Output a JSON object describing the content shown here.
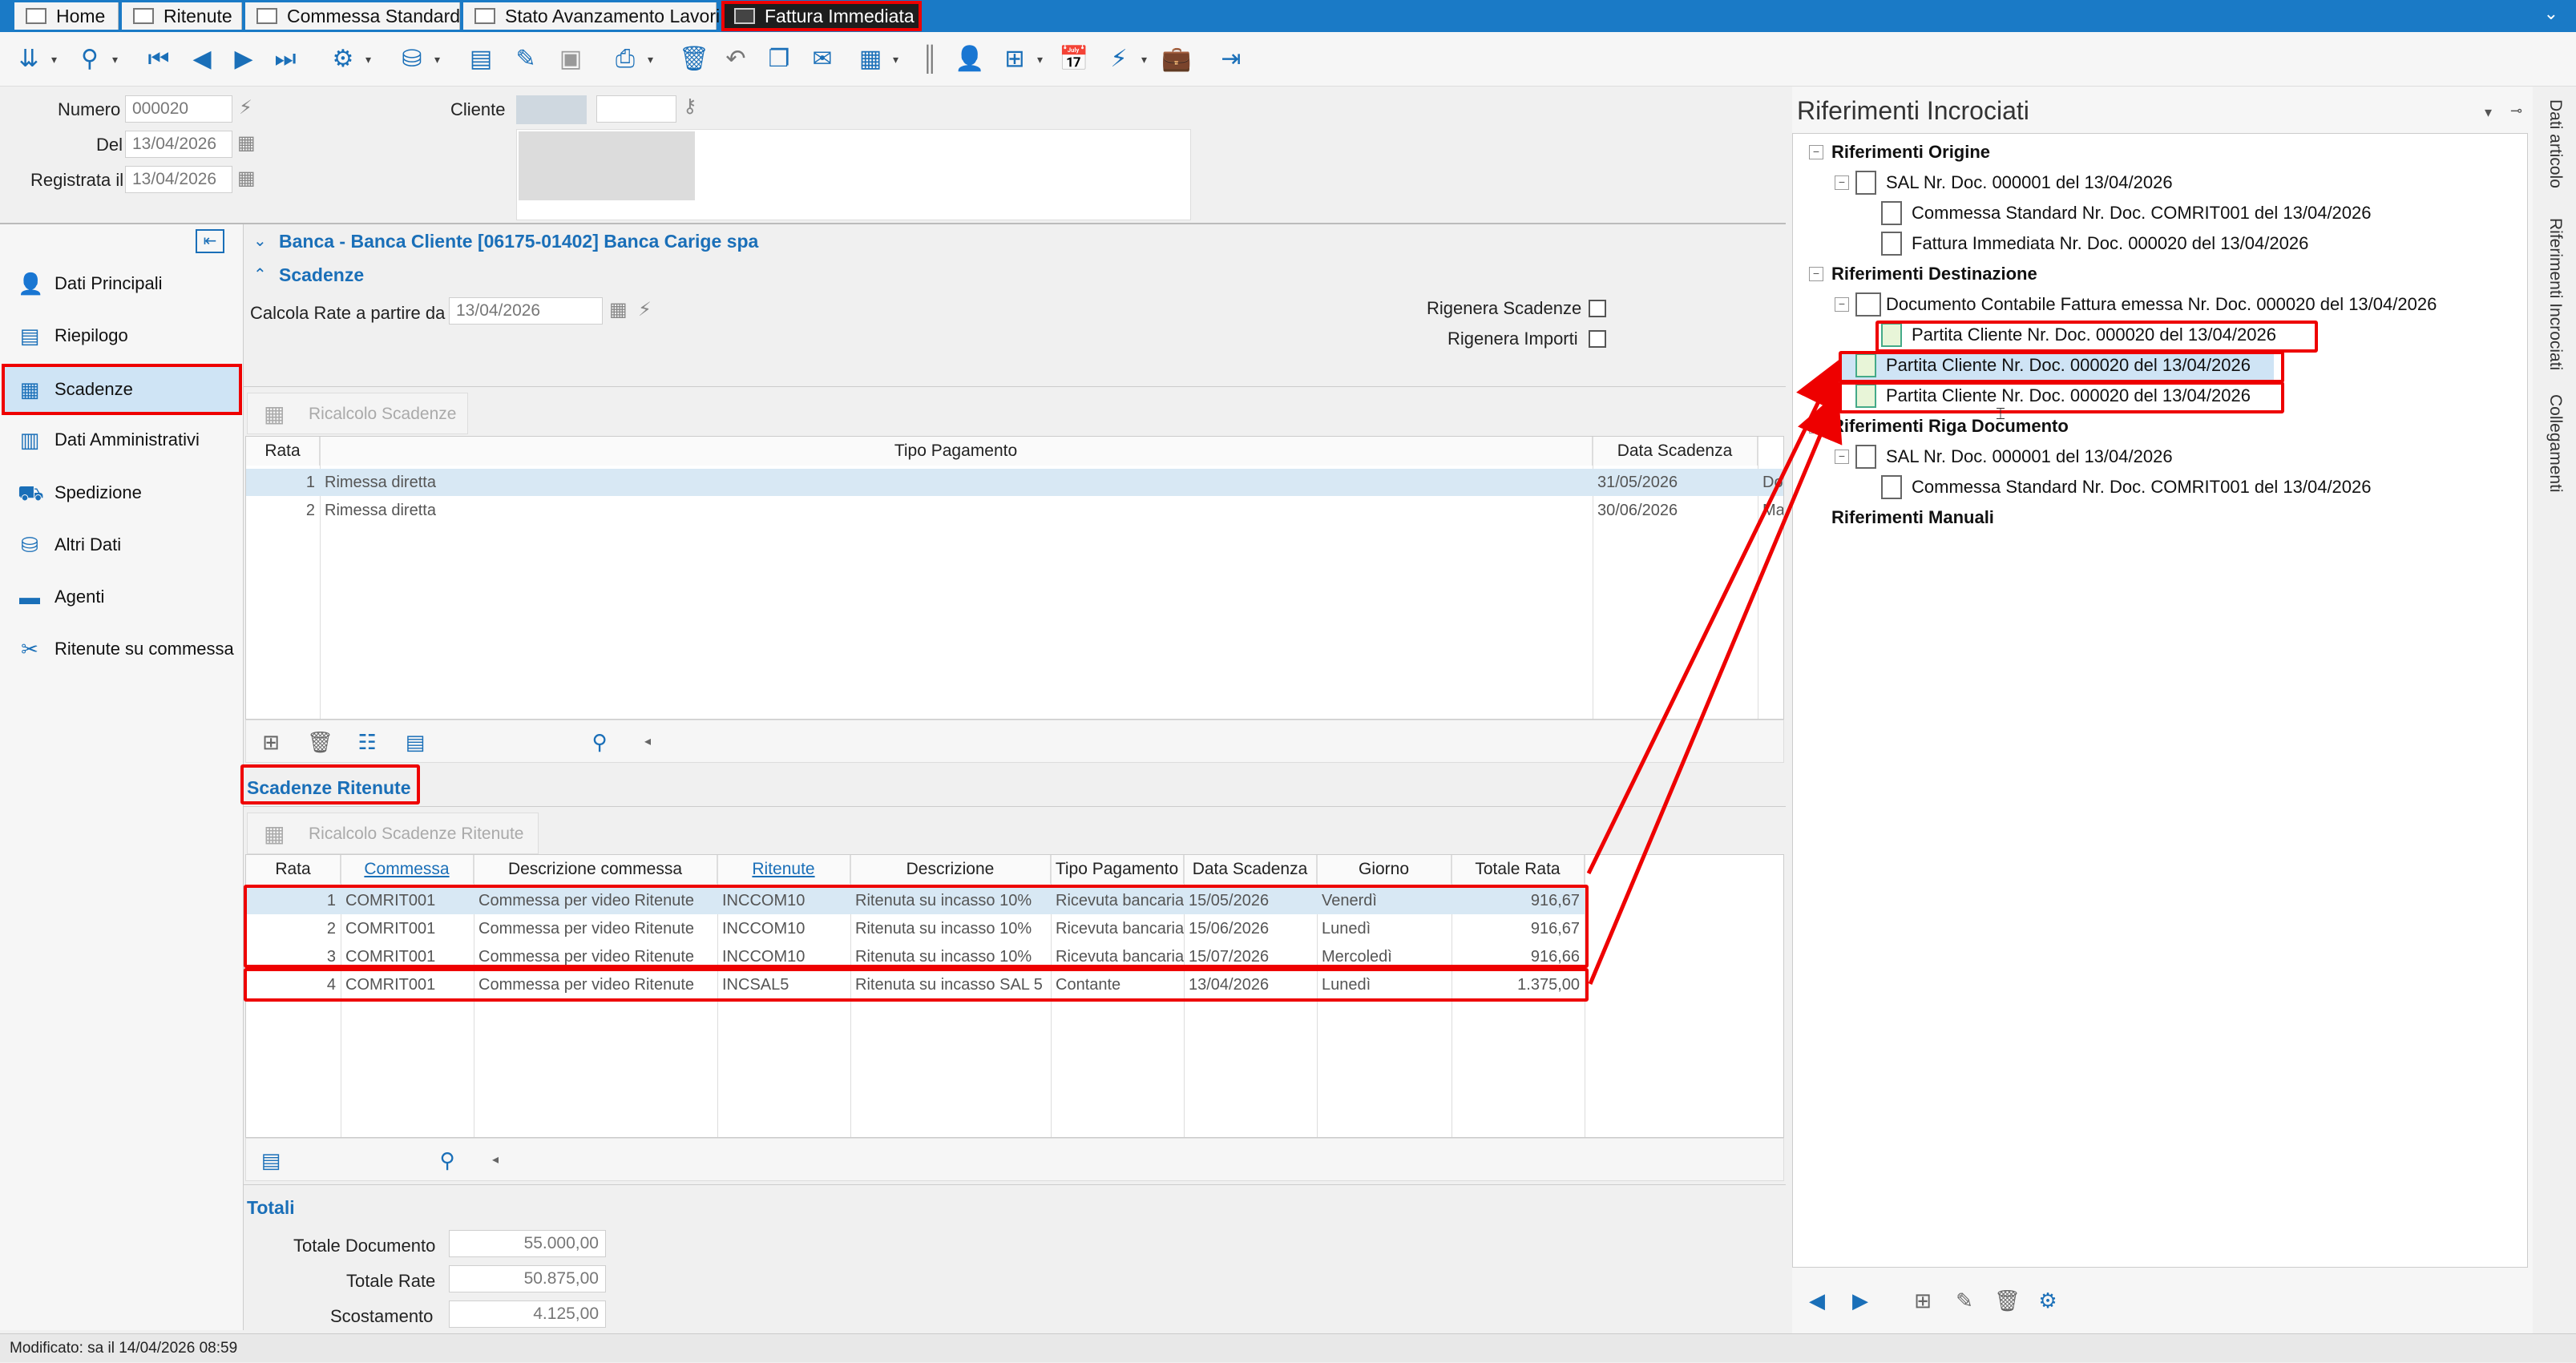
{
  "tabs": [
    {
      "label": "Home",
      "icon": "home-icon"
    },
    {
      "label": "Ritenute",
      "icon": "document-icon"
    },
    {
      "label": "Commessa Standard",
      "icon": "document-icon"
    },
    {
      "label": "Stato Avanzamento Lavori",
      "icon": "document-icon"
    },
    {
      "label": "Fattura Immediata",
      "icon": "invoice-icon",
      "active": true
    }
  ],
  "header": {
    "numero_label": "Numero",
    "numero_value": "000020",
    "del_label": "Del",
    "del_value": "13/04/2026",
    "registrata_label": "Registrata il",
    "registrata_value": "13/04/2026",
    "cliente_label": "Cliente"
  },
  "sidebar": {
    "items": [
      {
        "label": "Dati Principali",
        "icon": "user-icon"
      },
      {
        "label": "Riepilogo",
        "icon": "summary-icon"
      },
      {
        "label": "Scadenze",
        "icon": "calendar-icon",
        "selected": true
      },
      {
        "label": "Dati Amministrativi",
        "icon": "admin-icon"
      },
      {
        "label": "Spedizione",
        "icon": "truck-icon"
      },
      {
        "label": "Altri Dati",
        "icon": "data-icon"
      },
      {
        "label": "Agenti",
        "icon": "briefcase-icon"
      },
      {
        "label": "Ritenute su commessa",
        "icon": "tools-icon"
      }
    ]
  },
  "banca": {
    "label": "Banca - Banca Cliente [06175-01402] Banca Carige spa"
  },
  "scadenze": {
    "title": "Scadenze",
    "calcola_label": "Calcola Rate a partire da",
    "calcola_value": "13/04/2026",
    "rigenera_scadenze": "Rigenera Scadenze",
    "rigenera_importi": "Rigenera Importi",
    "ricalcolo_button": "Ricalcolo Scadenze",
    "columns": [
      "Rata",
      "Tipo Pagamento",
      "Data Scadenza"
    ],
    "rows": [
      {
        "rata": "1",
        "tipo": "Rimessa diretta",
        "data": "31/05/2026",
        "extra": "Dom"
      },
      {
        "rata": "2",
        "tipo": "Rimessa diretta",
        "data": "30/06/2026",
        "extra": "Mar"
      }
    ]
  },
  "scadenze_ritenute": {
    "title": "Scadenze Ritenute",
    "ricalcolo_button": "Ricalcolo Scadenze Ritenute",
    "columns": [
      "Rata",
      "Commessa",
      "Descrizione commessa",
      "Ritenute",
      "Descrizione",
      "Tipo Pagamento",
      "Data Scadenza",
      "Giorno",
      "Totale Rata"
    ],
    "rows": [
      {
        "rata": "1",
        "commessa": "COMRIT001",
        "desc_commessa": "Commessa per video Ritenute",
        "ritenute": "INCCOM10",
        "descrizione": "Ritenuta su incasso 10%",
        "tipo": "Ricevuta bancaria",
        "data": "15/05/2026",
        "giorno": "Venerdì",
        "totale": "916,67"
      },
      {
        "rata": "2",
        "commessa": "COMRIT001",
        "desc_commessa": "Commessa per video Ritenute",
        "ritenute": "INCCOM10",
        "descrizione": "Ritenuta su incasso 10%",
        "tipo": "Ricevuta bancaria",
        "data": "15/06/2026",
        "giorno": "Lunedì",
        "totale": "916,67"
      },
      {
        "rata": "3",
        "commessa": "COMRIT001",
        "desc_commessa": "Commessa per video Ritenute",
        "ritenute": "INCCOM10",
        "descrizione": "Ritenuta su incasso 10%",
        "tipo": "Ricevuta bancaria",
        "data": "15/07/2026",
        "giorno": "Mercoledì",
        "totale": "916,66"
      },
      {
        "rata": "4",
        "commessa": "COMRIT001",
        "desc_commessa": "Commessa per video Ritenute",
        "ritenute": "INCSAL5",
        "descrizione": "Ritenuta su incasso SAL 5",
        "tipo": "Contante",
        "data": "13/04/2026",
        "giorno": "Lunedì",
        "totale": "1.375,00"
      }
    ]
  },
  "totali": {
    "title": "Totali",
    "documento_label": "Totale Documento",
    "documento_value": "55.000,00",
    "rate_label": "Totale Rate",
    "rate_value": "50.875,00",
    "scostamento_label": "Scostamento",
    "scostamento_value": "4.125,00"
  },
  "riferimenti": {
    "title": "Riferimenti Incrociati",
    "origine": "Riferimenti Origine",
    "origine_items": [
      "SAL Nr. Doc. 000001 del 13/04/2026",
      "Commessa Standard Nr. Doc. COMRIT001 del 13/04/2026",
      "Fattura Immediata Nr. Doc. 000020 del 13/04/2026"
    ],
    "destinazione": "Riferimenti Destinazione",
    "dest_items": [
      "Documento Contabile Fattura emessa Nr. Doc. 000020 del 13/04/2026",
      "Partita Cliente Nr. Doc. 000020 del 13/04/2026",
      "Partita Cliente Nr. Doc. 000020 del 13/04/2026",
      "Partita Cliente Nr. Doc. 000020 del 13/04/2026"
    ],
    "riga": "Riferimenti Riga Documento",
    "riga_items": [
      "SAL Nr. Doc. 000001 del 13/04/2026",
      "Commessa Standard Nr. Doc. COMRIT001 del 13/04/2026"
    ],
    "manuali": "Riferimenti Manuali"
  },
  "vertical_tabs": [
    "Dati articolo",
    "Riferimenti Incrociati",
    "Collegamenti"
  ],
  "status": "Modificato: sa il 14/04/2026 08:59",
  "colors": {
    "accent": "#1a7ac6",
    "highlight": "#e00000",
    "selection": "#cfe4f5"
  }
}
